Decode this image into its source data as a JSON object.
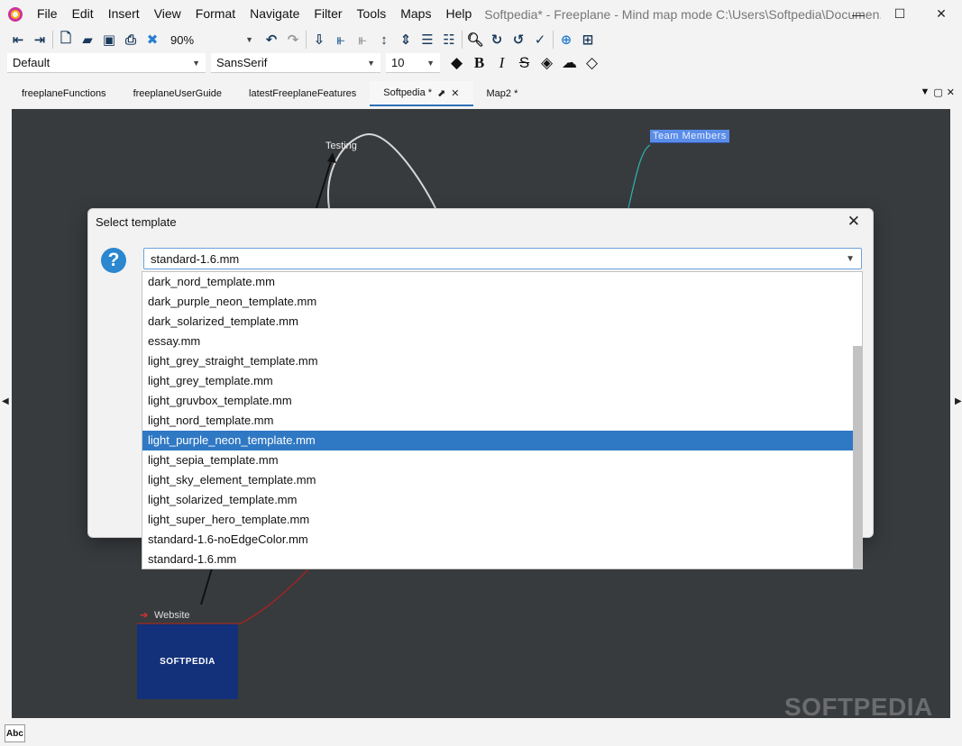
{
  "window": {
    "title": "Softpedia* - Freeplane - Mind map mode C:\\Users\\Softpedia\\Documen...",
    "minimize": "—",
    "maximize": "☐",
    "close": "✕"
  },
  "menu": [
    "File",
    "Edit",
    "Insert",
    "View",
    "Format",
    "Navigate",
    "Filter",
    "Tools",
    "Maps",
    "Help"
  ],
  "toolbar": {
    "zoom": "90%",
    "style": "Default",
    "font": "SansSerif",
    "font_size": "10",
    "bold": "B",
    "italic": "I",
    "strike": "S"
  },
  "tabs": [
    {
      "label": "freeplaneFunctions"
    },
    {
      "label": "freeplaneUserGuide"
    },
    {
      "label": "latestFreeplaneFeatures"
    },
    {
      "label": "Softpedia *",
      "active": true
    },
    {
      "label": "Map2 *"
    }
  ],
  "canvas": {
    "nodes": {
      "testing": "Testing",
      "team_members": "Team Members",
      "website": "Website"
    },
    "image_text": "SOFTPEDIA",
    "watermark": "SOFTPEDIA"
  },
  "status": {
    "abc": "Abc"
  },
  "dialog": {
    "title": "Select template",
    "close": "✕",
    "question_mark": "?",
    "selected_value": "standard-1.6.mm",
    "options": [
      "dark_nord_template.mm",
      "dark_purple_neon_template.mm",
      "dark_solarized_template.mm",
      "essay.mm",
      "light_grey_straight_template.mm",
      "light_grey_template.mm",
      "light_gruvbox_template.mm",
      "light_nord_template.mm",
      "light_purple_neon_template.mm",
      "light_sepia_template.mm",
      "light_sky_element_template.mm",
      "light_solarized_template.mm",
      "light_super_hero_template.mm",
      "standard-1.6-noEdgeColor.mm",
      "standard-1.6.mm"
    ],
    "highlighted_index": 8
  },
  "colors": {
    "accent": "#2f78c4",
    "canvas_bg": "#383b3e",
    "node_blue": "#5b8de8"
  }
}
